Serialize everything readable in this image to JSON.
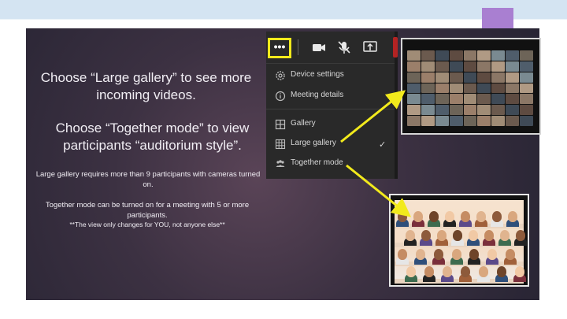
{
  "slide": {
    "line1": "Choose “Large gallery” to see more incoming videos.",
    "line2": "Choose “Together mode” to view participants “auditorium style”.",
    "note1": "Large gallery requires more than 9 participants with cameras turned on.",
    "note2": "Together mode can be turned on for a meeting with 5 or more participants.",
    "note3": "**The view only changes for YOU, not anyone else**"
  },
  "menu": {
    "more_glyph": "•••",
    "items": [
      {
        "label": "Device settings",
        "icon": "gear-icon"
      },
      {
        "label": "Meeting details",
        "icon": "info-icon"
      },
      {
        "label": "Gallery",
        "icon": "grid-icon"
      },
      {
        "label": "Large gallery",
        "icon": "large-grid-icon",
        "checked": true
      },
      {
        "label": "Together mode",
        "icon": "people-icon"
      }
    ],
    "check_glyph": "✓",
    "toolbar_icons": [
      "more-icon",
      "camera-icon",
      "mic-off-icon",
      "share-icon"
    ]
  },
  "colors": {
    "highlight": "#f2ea1c",
    "accent_tab": "#a97fd1",
    "menu_bg": "#292929"
  }
}
